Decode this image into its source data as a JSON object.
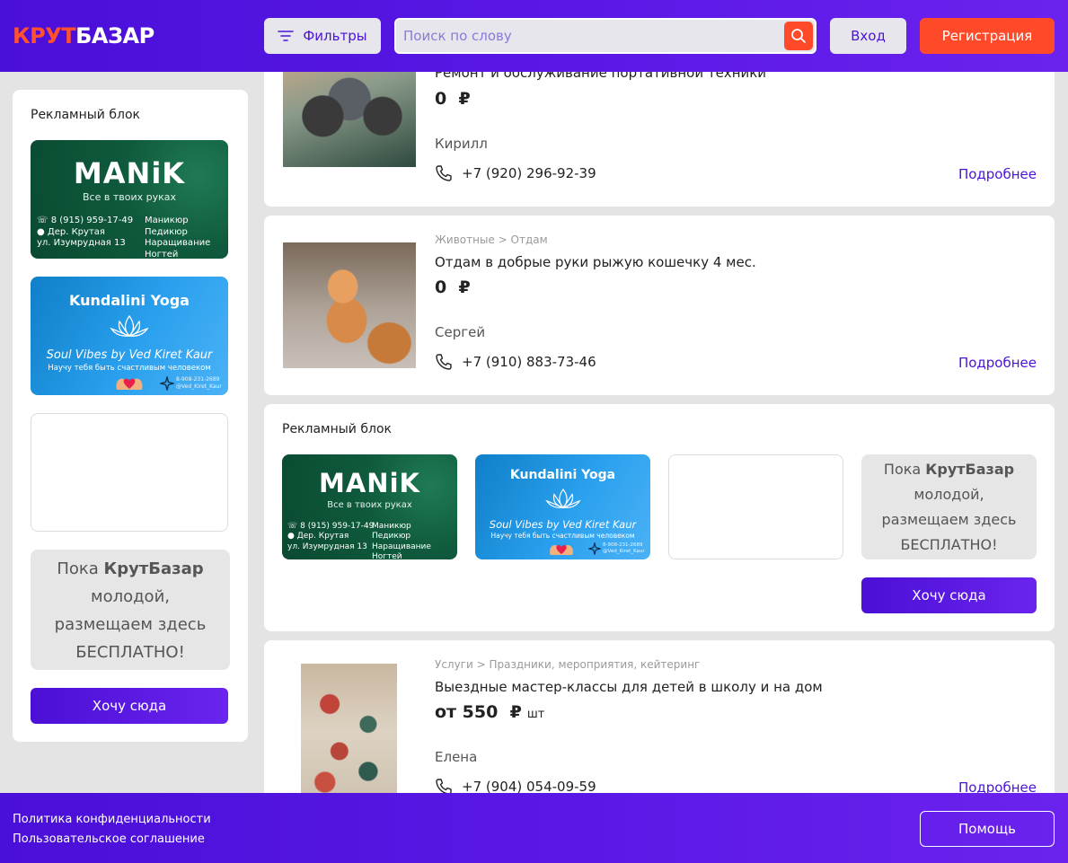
{
  "header": {
    "logo_part1": "КРУТ",
    "logo_part2": "БАЗАР",
    "filters_label": "Фильтры",
    "search_placeholder": "Поиск по слову",
    "login_label": "Вход",
    "register_label": "Регистрация"
  },
  "ads": {
    "title": "Рекламный блок",
    "manik": {
      "brand": "MANiK",
      "tagline": "Все в твоих руках",
      "phone": "8 (915) 959-17-49",
      "village": "Дер. Крутая",
      "street": "ул. Изумрудная  13",
      "service1": "Маникюр",
      "service2": "Педикюр",
      "service3": "Наращивание Ногтей"
    },
    "yoga": {
      "title": "Kundalini Yoga",
      "subtitle": "Soul Vibes by Ved Kiret Kaur",
      "slogan": "Научу тебя быть счастливым человеком",
      "contact_phone": "8-908-231-2689",
      "contact_handle": "@Ved_Kiret_Kaur"
    },
    "free": {
      "line1": "Пока",
      "brand": "КрутБазар",
      "line2": "молодой,",
      "line3": "размещаем здесь",
      "line4": "БЕСПЛАТНО!"
    },
    "cta_label": "Хочу сюда"
  },
  "listings": [
    {
      "category": "",
      "title": "Ремонт и обслуживание портативной техники",
      "price": "0",
      "currency": "₽",
      "unit": "",
      "person": "Кирилл",
      "phone": "+7 (920) 296-92-39",
      "more": "Подробнее"
    },
    {
      "category": "Животные  >  Отдам",
      "title": "Отдам в добрые руки рыжую кошечку 4 мес.",
      "price": "0",
      "currency": "₽",
      "unit": "",
      "person": "Сергей",
      "phone": "+7 (910) 883-73-46",
      "more": "Подробнее"
    },
    {
      "category": "Услуги  >  Праздники, мероприятия, кейтеринг",
      "title": "Выездные мастер-классы для детей в школу и на дом",
      "price": "от 550",
      "currency": "₽",
      "unit": "шт",
      "person": "Елена",
      "phone": "+7 (904) 054-09-59",
      "more": "Подробнее"
    }
  ],
  "footer": {
    "privacy": "Политика конфиденциальности",
    "terms": "Пользовательское соглашение",
    "help": "Помощь"
  },
  "colors": {
    "brand_purple": "#5a18e6",
    "accent_red": "#ff4a2a",
    "link": "#4b12d8"
  }
}
